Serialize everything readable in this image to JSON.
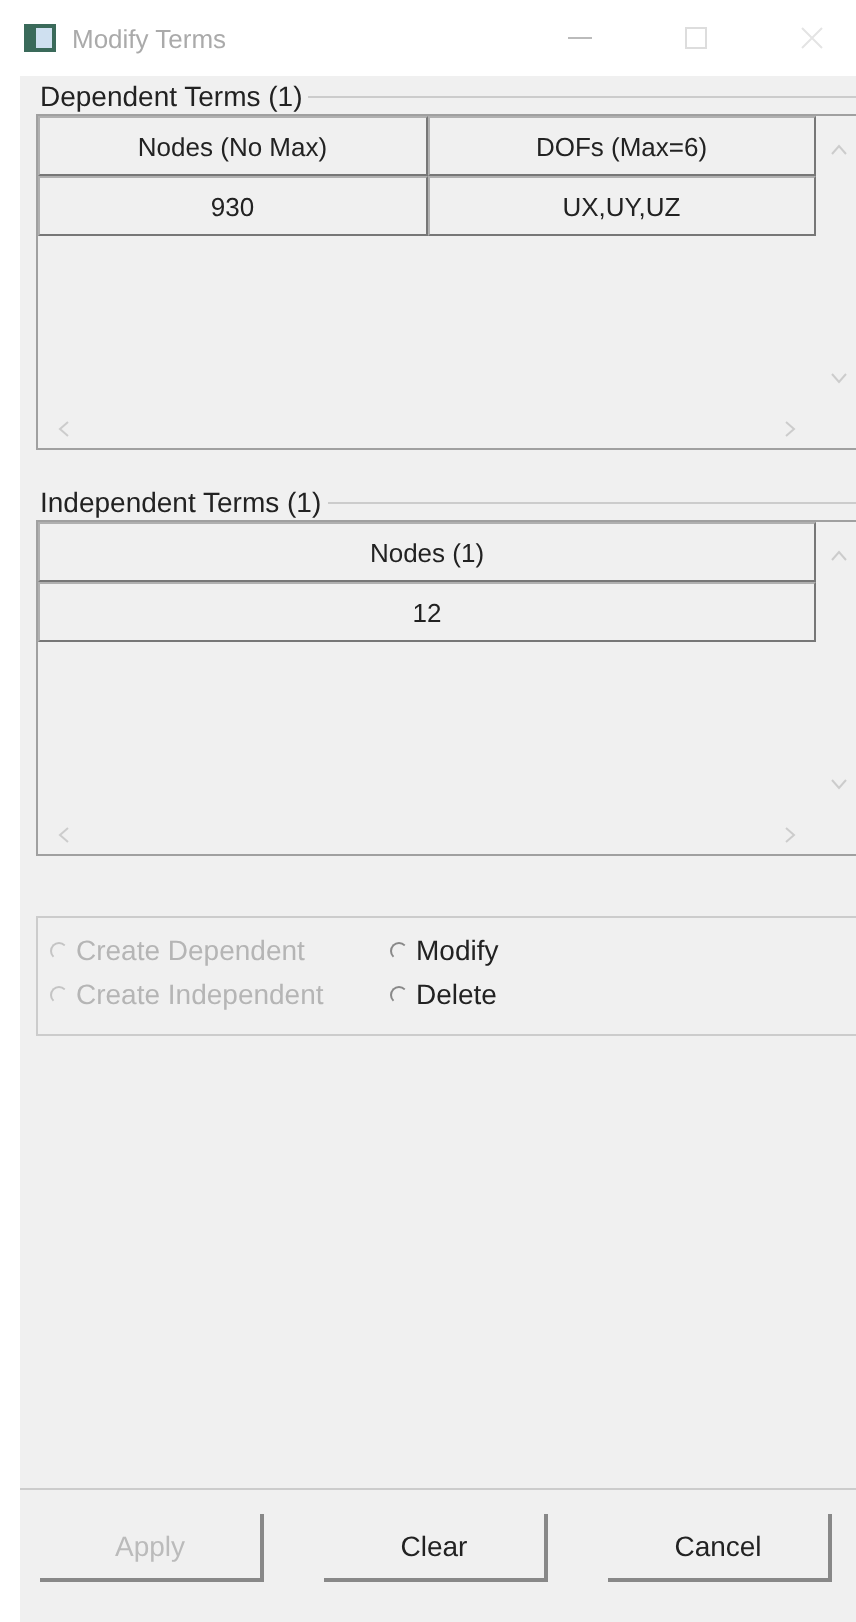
{
  "window": {
    "title": "Modify Terms"
  },
  "dependent": {
    "legend": "Dependent Terms (1)",
    "columns": [
      "Nodes (No Max)",
      "DOFs (Max=6)"
    ],
    "rows": [
      [
        "930",
        "UX,UY,UZ"
      ]
    ]
  },
  "independent": {
    "legend": "Independent Terms (1)",
    "columns": [
      "Nodes (1)"
    ],
    "rows": [
      [
        "12"
      ]
    ]
  },
  "radios": [
    {
      "label": "Create Dependent",
      "selected": false,
      "disabled": true
    },
    {
      "label": "Modify",
      "selected": false,
      "disabled": false
    },
    {
      "label": "Create Independent",
      "selected": false,
      "disabled": true
    },
    {
      "label": "Delete",
      "selected": false,
      "disabled": false
    }
  ],
  "buttons": [
    {
      "label": "Apply",
      "disabled": true
    },
    {
      "label": "Clear",
      "disabled": false
    },
    {
      "label": "Cancel",
      "disabled": false
    }
  ]
}
